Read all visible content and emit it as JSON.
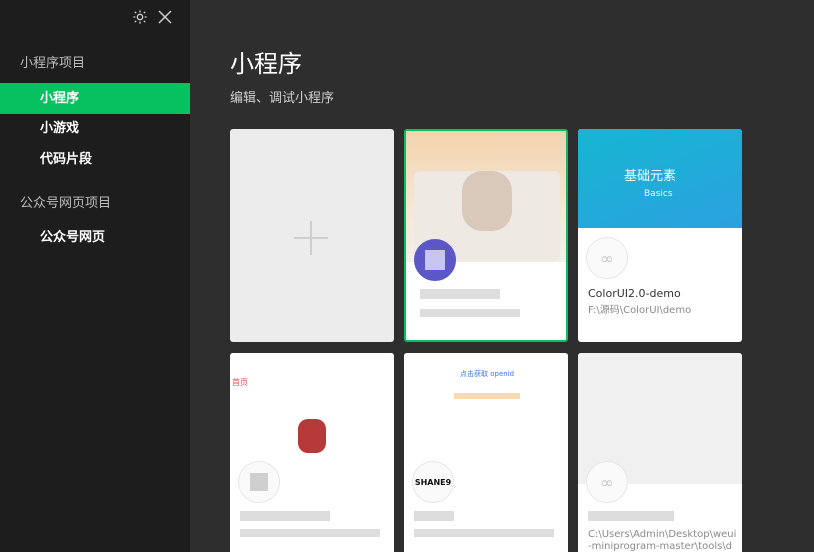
{
  "sidebar": {
    "groups": [
      {
        "label": "小程序项目",
        "items": [
          {
            "label": "小程序"
          },
          {
            "label": "小游戏"
          },
          {
            "label": "代码片段"
          }
        ]
      },
      {
        "label": "公众号网页项目",
        "items": [
          {
            "label": "公众号网页"
          }
        ]
      }
    ]
  },
  "main": {
    "title": "小程序",
    "subtitle": "编辑、调试小程序"
  },
  "cards": [
    {
      "name": "",
      "path": ""
    },
    {
      "name": "ColorUI2.0-demo",
      "path": "F:\\源码\\ColorUI\\demo",
      "thumb_text": "基础元素",
      "thumb_sub": "Basics"
    },
    {
      "name": "",
      "path": "",
      "thumb_text": "首页"
    },
    {
      "name": "",
      "path": "",
      "thumb_text": "点击获取 openid",
      "badge": "SHANE9"
    },
    {
      "name": "",
      "path": "C:\\Users\\Admin\\Desktop\\weui-miniprogram-master\\tools\\demo"
    }
  ],
  "colors": {
    "accent": "#07c160",
    "sidebar": "#1d1d1d",
    "main": "#2e2e2e"
  }
}
